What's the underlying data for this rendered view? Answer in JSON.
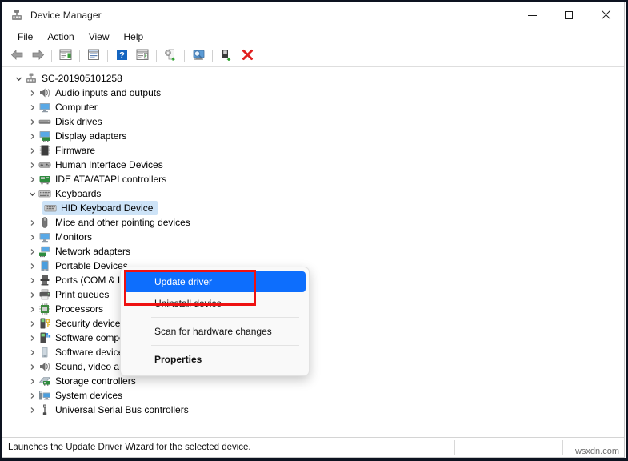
{
  "window": {
    "title": "Device Manager",
    "app_icon": "device-manager-icon",
    "caption": {
      "minimize": "minimize-button",
      "maximize": "maximize-button",
      "close": "close-button"
    }
  },
  "menubar": {
    "items": [
      {
        "label": "File"
      },
      {
        "label": "Action"
      },
      {
        "label": "View"
      },
      {
        "label": "Help"
      }
    ]
  },
  "toolbar": {
    "buttons": [
      {
        "name": "back-button",
        "icon": "left-arrow-icon"
      },
      {
        "name": "forward-button",
        "icon": "right-arrow-icon"
      },
      {
        "name": "separator-1",
        "icon": "separator"
      },
      {
        "name": "show-hide-console-tree-button",
        "icon": "console-tree-icon"
      },
      {
        "name": "separator-2",
        "icon": "separator"
      },
      {
        "name": "properties-button",
        "icon": "properties-window-icon"
      },
      {
        "name": "separator-3",
        "icon": "separator"
      },
      {
        "name": "help-button",
        "icon": "question-mark-icon"
      },
      {
        "name": "show-hide-action-pane-button",
        "icon": "action-pane-icon"
      },
      {
        "name": "separator-4",
        "icon": "separator"
      },
      {
        "name": "update-driver-button",
        "icon": "update-driver-icon"
      },
      {
        "name": "separator-5",
        "icon": "separator"
      },
      {
        "name": "scan-for-hardware-changes-button",
        "icon": "scan-hardware-icon"
      },
      {
        "name": "separator-6",
        "icon": "separator"
      },
      {
        "name": "enable-device-button",
        "icon": "enable-device-icon"
      },
      {
        "name": "uninstall-device-button",
        "icon": "red-x-icon"
      }
    ]
  },
  "tree": {
    "root": {
      "label": "SC-201905101258",
      "icon": "computer-root-icon",
      "expanded": true,
      "chevron": "chevron-down-icon"
    },
    "nodes": [
      {
        "label": "Audio inputs and outputs",
        "icon": "speaker-icon",
        "chevron": "chevron-right-icon",
        "level": 1,
        "selected": false
      },
      {
        "label": "Computer",
        "icon": "monitor-icon",
        "chevron": "chevron-right-icon",
        "level": 1,
        "selected": false
      },
      {
        "label": "Disk drives",
        "icon": "disk-drive-icon",
        "chevron": "chevron-right-icon",
        "level": 1,
        "selected": false
      },
      {
        "label": "Display adapters",
        "icon": "display-adapter-icon",
        "chevron": "chevron-right-icon",
        "level": 1,
        "selected": false
      },
      {
        "label": "Firmware",
        "icon": "firmware-chip-icon",
        "chevron": "chevron-right-icon",
        "level": 1,
        "selected": false
      },
      {
        "label": "Human Interface Devices",
        "icon": "hid-gamepad-icon",
        "chevron": "chevron-right-icon",
        "level": 1,
        "selected": false
      },
      {
        "label": "IDE ATA/ATAPI controllers",
        "icon": "ide-controller-icon",
        "chevron": "chevron-right-icon",
        "level": 1,
        "selected": false
      },
      {
        "label": "Keyboards",
        "icon": "keyboard-icon",
        "chevron": "chevron-down-icon",
        "level": 1,
        "selected": false
      },
      {
        "label": "HID Keyboard Device",
        "icon": "keyboard-icon",
        "chevron": "",
        "level": 2,
        "selected": true
      },
      {
        "label": "Mice and other pointing devices",
        "icon": "mouse-icon",
        "chevron": "chevron-right-icon",
        "level": 1,
        "selected": false
      },
      {
        "label": "Monitors",
        "icon": "monitor-icon",
        "chevron": "chevron-right-icon",
        "level": 1,
        "selected": false
      },
      {
        "label": "Network adapters",
        "icon": "network-adapter-icon",
        "chevron": "chevron-right-icon",
        "level": 1,
        "selected": false
      },
      {
        "label": "Portable Devices",
        "icon": "portable-device-icon",
        "chevron": "chevron-right-icon",
        "level": 1,
        "selected": false
      },
      {
        "label": "Ports (COM & LPT)",
        "icon": "port-icon",
        "chevron": "chevron-right-icon",
        "level": 1,
        "selected": false
      },
      {
        "label": "Print queues",
        "icon": "printer-icon",
        "chevron": "chevron-right-icon",
        "level": 1,
        "selected": false
      },
      {
        "label": "Processors",
        "icon": "processor-icon",
        "chevron": "chevron-right-icon",
        "level": 1,
        "selected": false
      },
      {
        "label": "Security devices",
        "icon": "security-device-icon",
        "chevron": "chevron-right-icon",
        "level": 1,
        "selected": false
      },
      {
        "label": "Software components",
        "icon": "software-component-icon",
        "chevron": "chevron-right-icon",
        "level": 1,
        "selected": false
      },
      {
        "label": "Software devices",
        "icon": "software-device-icon",
        "chevron": "chevron-right-icon",
        "level": 1,
        "selected": false
      },
      {
        "label": "Sound, video and game controllers",
        "icon": "speaker-icon",
        "chevron": "chevron-right-icon",
        "level": 1,
        "selected": false
      },
      {
        "label": "Storage controllers",
        "icon": "storage-controller-icon",
        "chevron": "chevron-right-icon",
        "level": 1,
        "selected": false
      },
      {
        "label": "System devices",
        "icon": "system-device-icon",
        "chevron": "chevron-right-icon",
        "level": 1,
        "selected": false
      },
      {
        "label": "Universal Serial Bus controllers",
        "icon": "usb-icon",
        "chevron": "chevron-right-icon",
        "level": 1,
        "selected": false
      }
    ]
  },
  "context_menu": {
    "items": [
      {
        "label": "Update driver",
        "highlighted": true,
        "bold": false
      },
      {
        "label": "Uninstall device",
        "highlighted": false,
        "bold": false
      },
      {
        "separator": true
      },
      {
        "label": "Scan for hardware changes",
        "highlighted": false,
        "bold": false
      },
      {
        "separator": true
      },
      {
        "label": "Properties",
        "highlighted": false,
        "bold": true
      }
    ]
  },
  "annotation": {
    "red_box_label": "red-highlight-box",
    "color": "#ee1111"
  },
  "statusbar": {
    "text": "Launches the Update Driver Wizard for the selected device.",
    "watermark": "wsxdn.com"
  },
  "colors": {
    "selection_blue": "#0d6efd",
    "tree_selection": "#cde3f7",
    "annotation_red": "#ee1111",
    "window_bg": "#ffffff"
  }
}
